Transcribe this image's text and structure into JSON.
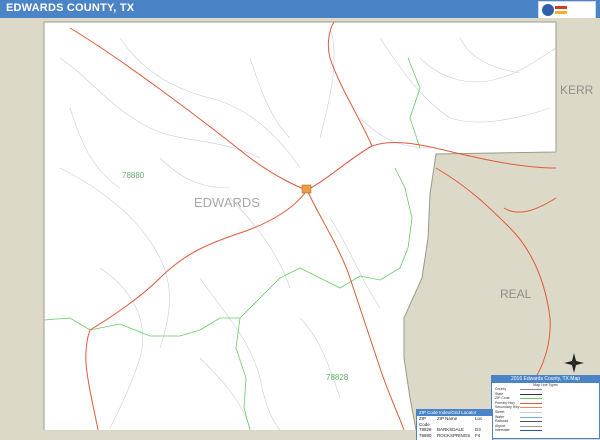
{
  "title": "EDWARDS COUNTY, TX",
  "county_label": "EDWARDS",
  "neighbors": [
    "KERR",
    "REAL"
  ],
  "zip_labels": [
    "78880",
    "78828"
  ],
  "colors": {
    "header": "#4a84c6",
    "outside_county": "#ddd9c8",
    "major_road": "#e05a3a",
    "zip_boundary": "#66cc66",
    "minor_road": "#c8cedc"
  },
  "legend": {
    "title": "2016 Edwards County, TX Map",
    "subtitle": "Map Line Types",
    "rows": [
      {
        "name": "County",
        "right": "",
        "swatch": "#888888"
      },
      {
        "name": "State",
        "right": "",
        "swatch": "#333333"
      },
      {
        "name": "ZIP Code",
        "right": "",
        "swatch": "#66cc66"
      },
      {
        "name": "Primary Hwy",
        "right": "",
        "swatch": "#e05a3a"
      },
      {
        "name": "Secondary Hwy",
        "right": "",
        "swatch": "#e08a6a"
      },
      {
        "name": "Street",
        "right": "",
        "swatch": "#c8cedc"
      },
      {
        "name": "Water",
        "right": "",
        "swatch": "#7aaadd"
      },
      {
        "name": "Railroad",
        "right": "",
        "swatch": "#555555"
      },
      {
        "name": "Airport",
        "right": "",
        "swatch": "#999999"
      },
      {
        "name": "Interstate",
        "right": "",
        "swatch": "#3355bb"
      }
    ]
  },
  "zip_locator": {
    "title": "ZIP Code Index/Grid Locator",
    "columns": [
      "ZIP Code",
      "ZIP Name",
      "Loc"
    ],
    "rows": [
      [
        "78828",
        "BARKSDALE",
        "D3"
      ],
      [
        "78880",
        "ROCKSPRINGS",
        "F4"
      ]
    ]
  },
  "icons": {
    "compass": "compass-rose-icon",
    "logo": "publisher-logo-icon"
  }
}
